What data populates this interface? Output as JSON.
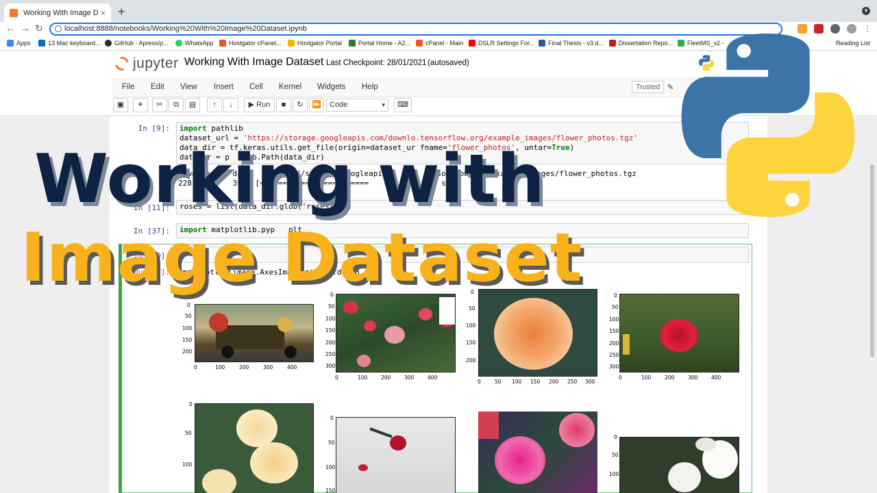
{
  "browser": {
    "tab_title": "Working With Image Dataset -",
    "tab_close": "×",
    "new_tab": "+",
    "url": "localhost:8888/notebooks/Working%20With%20Image%20Dataset.ipynb",
    "bookmarks": [
      {
        "label": "Apps",
        "color": "#4285f4"
      },
      {
        "label": "13 Mac keyboard...",
        "color": "#1565c0"
      },
      {
        "label": "GitHub - Apress/p...",
        "color": "#24292e"
      },
      {
        "label": "WhatsApp",
        "color": "#25d366"
      },
      {
        "label": "Hostgator cPanel...",
        "color": "#e8572a"
      },
      {
        "label": "Hostgator Portal",
        "color": "#f4b400"
      },
      {
        "label": "Portal Home - A2...",
        "color": "#2e7d32"
      },
      {
        "label": "cPanel - Main",
        "color": "#e8572a"
      },
      {
        "label": "DSLR Settings For...",
        "color": "#ff0000"
      },
      {
        "label": "Final Thesis - v3.d...",
        "color": "#2b579a"
      },
      {
        "label": "Dissertation Repo...",
        "color": "#b71c1c"
      },
      {
        "label": "FleetMS_v2 -",
        "color": "#34a853"
      }
    ],
    "reading_list": "Reading List"
  },
  "jupyter": {
    "logo_text": "jupyter",
    "notebook_name": "Working With Image Dataset",
    "checkpoint": "Last Checkpoint: 28/01/2021",
    "autosave": "(autosaved)",
    "menu": [
      "File",
      "Edit",
      "View",
      "Insert",
      "Cell",
      "Kernel",
      "Widgets",
      "Help"
    ],
    "trusted": "Trusted",
    "run_label": "Run",
    "cell_type": "Code"
  },
  "cells": {
    "c9_prompt": "In [9]:",
    "c9_line1_kw": "import",
    "c9_line1_rest": " pathlib",
    "c9_line2_a": "dataset_url = ",
    "c9_line2_str": "'https://storage.googleapis.com/downlo",
    "c9_line2_str2": ".tensorflow.org/example_images/flower_photos.tgz'",
    "c9_line3_a": "data_dir = tf.keras.utils.get_file(origin=dataset_ur",
    "c9_line3_b": " fname=",
    "c9_line3_str": "'flower_photos'",
    "c9_line3_c": ", untar=",
    "c9_line3_kw": "True",
    "c9_line3_d": ")",
    "c9_line4": "dat dir = p   lib.Path(data_dir)",
    "c9_out1": "Downloading da      https://storage.googleapis.c        nsorflow.org/example_images/flower_photos.tgz",
    "c9_out2": "228   /22   39   [========================          s 0   step",
    "c11_prompt": "In [11]:",
    "c11_code": "roses = list(data_dir.glob('roses/*'))",
    "c37_prompt": "In [37]:",
    "c37_kw": "import",
    "c37_rest": " matplotlib.pyp   plt",
    "c40_prompt": "In [40]:",
    "c40_out_prompt": "Out[40]:",
    "c40_out": "<matplotlib.image.AxesImage at 0x7fd0f23       >"
  },
  "overlay": {
    "title_line1": "Working with",
    "title_line2": "Image Dataset",
    "colors": {
      "line1": "#0e2244",
      "line2": "#f9b21b",
      "python_blue": "#3c74a8",
      "python_yellow": "#fed43f"
    }
  },
  "plots": [
    {
      "yticks": [
        "0",
        "50",
        "100",
        "150",
        "200"
      ],
      "xticks": [
        "0",
        "100",
        "200",
        "300",
        "400"
      ],
      "subject": "vintage truck with flowers"
    },
    {
      "yticks": [
        "0",
        "50",
        "100",
        "150",
        "200",
        "250",
        "300"
      ],
      "xticks": [
        "0",
        "100",
        "200",
        "300",
        "400"
      ],
      "subject": "red and pink roses"
    },
    {
      "yticks": [
        "0",
        "50",
        "100",
        "150",
        "200"
      ],
      "xticks": [
        "0",
        "50",
        "100",
        "150",
        "200",
        "250",
        "300"
      ],
      "subject": "orange rose"
    },
    {
      "yticks": [
        "0",
        "50",
        "100",
        "150",
        "200",
        "250",
        "300"
      ],
      "xticks": [
        "0",
        "100",
        "200",
        "300",
        "400"
      ],
      "subject": "red rose"
    },
    {
      "yticks": [
        "0",
        "50",
        "100"
      ],
      "xticks": [],
      "subject": "cream roses"
    },
    {
      "yticks": [
        "0",
        "50",
        "100",
        "150"
      ],
      "xticks": [],
      "subject": "rose in snow"
    },
    {
      "yticks": [],
      "xticks": [],
      "subject": "pink roses"
    },
    {
      "yticks": [
        "0",
        "50",
        "100"
      ],
      "xticks": [],
      "subject": "white roses"
    }
  ]
}
